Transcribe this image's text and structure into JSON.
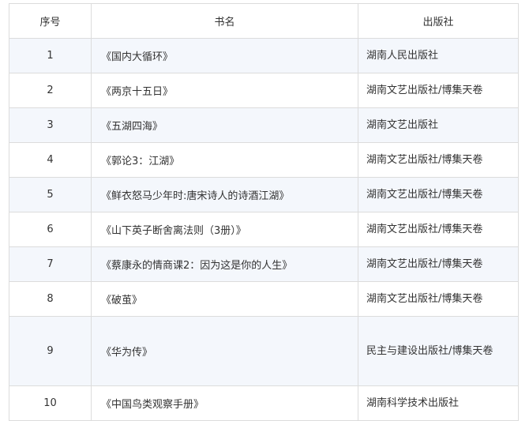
{
  "table": {
    "headers": {
      "num": "序号",
      "title": "书名",
      "publisher": "出版社"
    },
    "rows": [
      {
        "num": "1",
        "title": "《国内大循环》",
        "publisher": "湖南人民出版社"
      },
      {
        "num": "2",
        "title": "《两京十五日》",
        "publisher": "湖南文艺出版社/博集天卷"
      },
      {
        "num": "3",
        "title": "《五湖四海》",
        "publisher": "湖南文艺出版社"
      },
      {
        "num": "4",
        "title": "《郭论3：江湖》",
        "publisher": "湖南文艺出版社/博集天卷"
      },
      {
        "num": "5",
        "title": "《鲜衣怒马少年时:唐宋诗人的诗酒江湖》",
        "publisher": "湖南文艺出版社/博集天卷"
      },
      {
        "num": "6",
        "title": "《山下英子断舍离法则（3册）》",
        "publisher": "湖南文艺出版社/博集天卷"
      },
      {
        "num": "7",
        "title": "《蔡康永的情商课2：因为这是你的人生》",
        "publisher": "湖南文艺出版社/博集天卷"
      },
      {
        "num": "8",
        "title": "《破茧》",
        "publisher": "湖南文艺出版社/博集天卷"
      },
      {
        "num": "9",
        "title": "《华为传》",
        "publisher": "民主与建设出版社/博集天卷"
      },
      {
        "num": "10",
        "title": "《中国鸟类观察手册》",
        "publisher": "湖南科学技术出版社"
      }
    ]
  },
  "colors": {
    "border": "#dcdcdc",
    "alt_row": "#f4f7fc",
    "text": "#333333"
  }
}
